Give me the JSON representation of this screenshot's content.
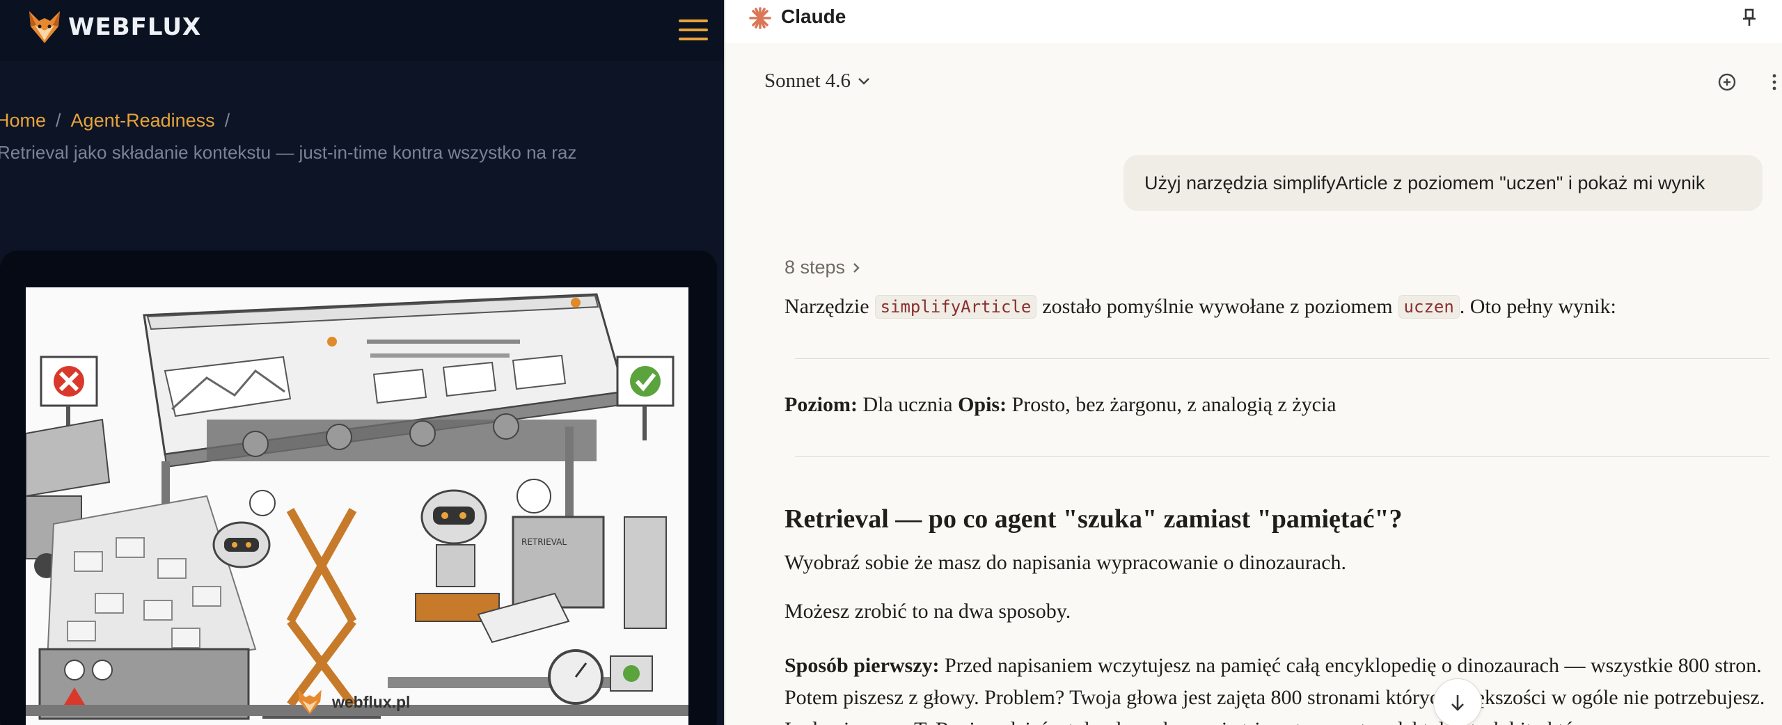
{
  "site": {
    "brand": "WEBFLUX",
    "breadcrumb": {
      "home": "Home",
      "section": "Agent-Readiness",
      "separator": "/",
      "current": "Retrieval jako składanie kontekstu — just-in-time kontra wszystko na raz"
    },
    "hero_watermark": "webflux.pl",
    "hero_labels": {
      "retrieval": "RETRIEVAL"
    },
    "colors": {
      "accent": "#e8a33a",
      "background": "#0c1426"
    }
  },
  "claude": {
    "title": "Claude",
    "model": "Sonnet 4.6",
    "user_message": "Użyj narzędzia simplifyArticle z poziomem \"uczen\" i pokaż mi wynik",
    "steps_label": "8 steps",
    "reply": {
      "intro_pre": "Narzędzie",
      "tool_name": "simplifyArticle",
      "intro_mid": "zostało pomyślnie wywołane z poziomem",
      "level_code": "uczen",
      "intro_post": ". Oto pełny wynik:",
      "level_label": "Poziom:",
      "level_value": "Dla ucznia",
      "desc_label": "Opis:",
      "desc_value": "Prosto, bez żargonu, z analogią z życia",
      "heading": "Retrieval — po co agent \"szuka\" zamiast \"pamiętać\"?",
      "p1": "Wyobraź sobie że masz do napisania wypracowanie o dinozaurach.",
      "p2": "Możesz zrobić to na dwa sposoby.",
      "p3_label": "Sposób pierwszy:",
      "p3_text": "Przed napisaniem wczytujesz na pamięć całą encyklopedię o dinozaurach — wszystkie 800 stron. Potem piszesz z głowy. Problem? Twoja głowa jest zajęta 800 stronami których większości w ogóle nie potrzebujesz. I gdy piszesz o T. Rexie, gdzieś z tyłu głowy kręcą się triceratopsy, pterodaktyle i trylobity które..."
    },
    "colors": {
      "accent": "#d97757",
      "code_text": "#8b2e2e"
    }
  }
}
